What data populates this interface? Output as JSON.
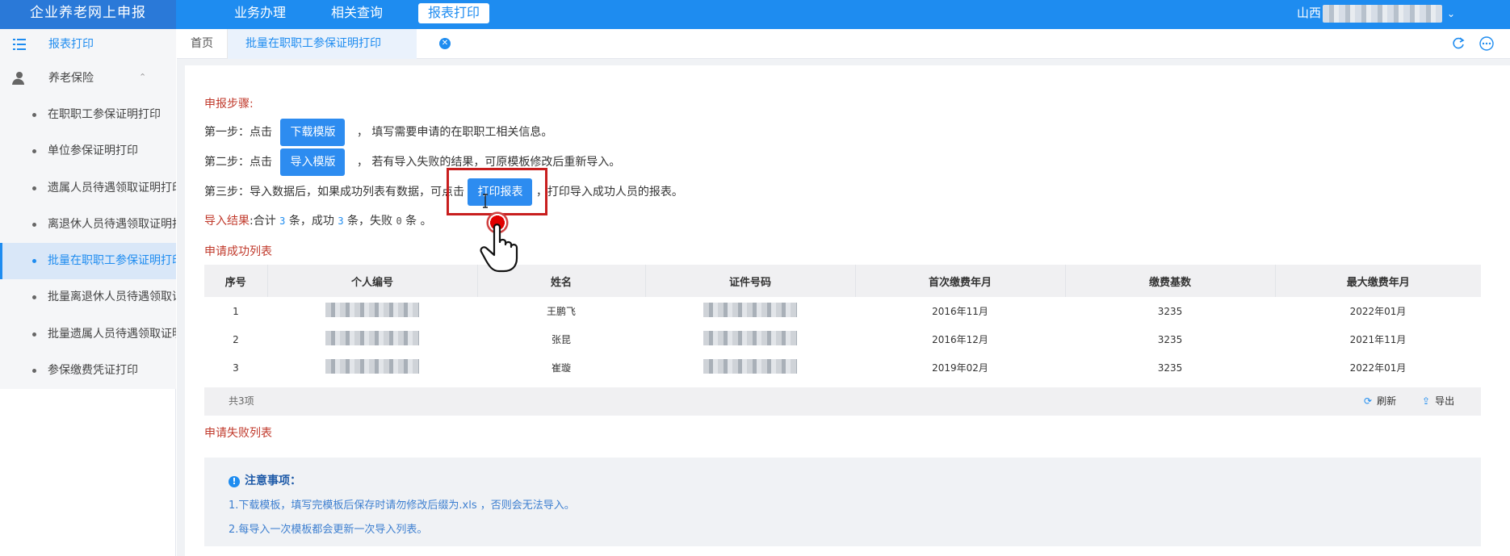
{
  "header": {
    "brand": "企业养老网上申报",
    "nav": [
      "业务办理",
      "相关查询",
      "报表打印"
    ],
    "active_nav": "报表打印",
    "region": "山西"
  },
  "sidebar": {
    "head": "报表打印",
    "group": "养老保险",
    "items": [
      "在职职工参保证明打印",
      "单位参保证明打印",
      "遗属人员待遇领取证明打印",
      "离退休人员待遇领取证明打印",
      "批量在职职工参保证明打印",
      "批量离退休人员待遇领取证明打印",
      "批量遗属人员待遇领取证明打印",
      "参保缴费凭证打印"
    ],
    "active_index": 4
  },
  "tabs": {
    "home": "首页",
    "current": "批量在职职工参保证明打印"
  },
  "steps": {
    "title": "申报步骤:",
    "s1_prefix": "第一步：点击",
    "s1_button": "下载模版",
    "s1_suffix": "，  填写需要申请的在职职工相关信息。",
    "s2_prefix": "第二步：点击",
    "s2_button": "导入模版",
    "s2_suffix": "，  若有导入失败的结果，可原模板修改后重新导入。",
    "s3_prefix": "第三步：导入数据后，如果成功列表有数据，可点击",
    "s3_button": "打印报表",
    "s3_suffix": "，打印导入成功人员的报表。"
  },
  "result": {
    "label": "导入结果",
    "text_a": ":合计 ",
    "total": "3",
    "text_b": " 条，成功 ",
    "success": "3",
    "text_c": " 条，失败 ",
    "fail": "0",
    "text_d": " 条 。"
  },
  "success_list": {
    "title": "申请成功列表",
    "columns": [
      "序号",
      "个人编号",
      "姓名",
      "证件号码",
      "首次缴费年月",
      "缴费基数",
      "最大缴费年月"
    ],
    "rows": [
      [
        "1",
        "",
        "王鹏飞",
        "",
        "2016年11月",
        "3235",
        "2022年01月"
      ],
      [
        "2",
        "",
        "张昆",
        "",
        "2016年12月",
        "3235",
        "2021年11月"
      ],
      [
        "3",
        "",
        "崔璇",
        "",
        "2019年02月",
        "3235",
        "2022年01月"
      ]
    ],
    "count": "共3项",
    "refresh": "刷新",
    "export": "导出"
  },
  "fail_list": {
    "title": "申请失败列表"
  },
  "notice": {
    "title": "注意事项：",
    "lines": [
      "1.下载模板，填写完模板后保存时请勿修改后缀为.xls ，否则会无法导入。",
      "2.每导入一次模板都会更新一次导入列表。"
    ]
  },
  "colors": {
    "primary": "#1e8cf0",
    "brand_bg": "#2a79d8",
    "red": "#c0392b"
  }
}
